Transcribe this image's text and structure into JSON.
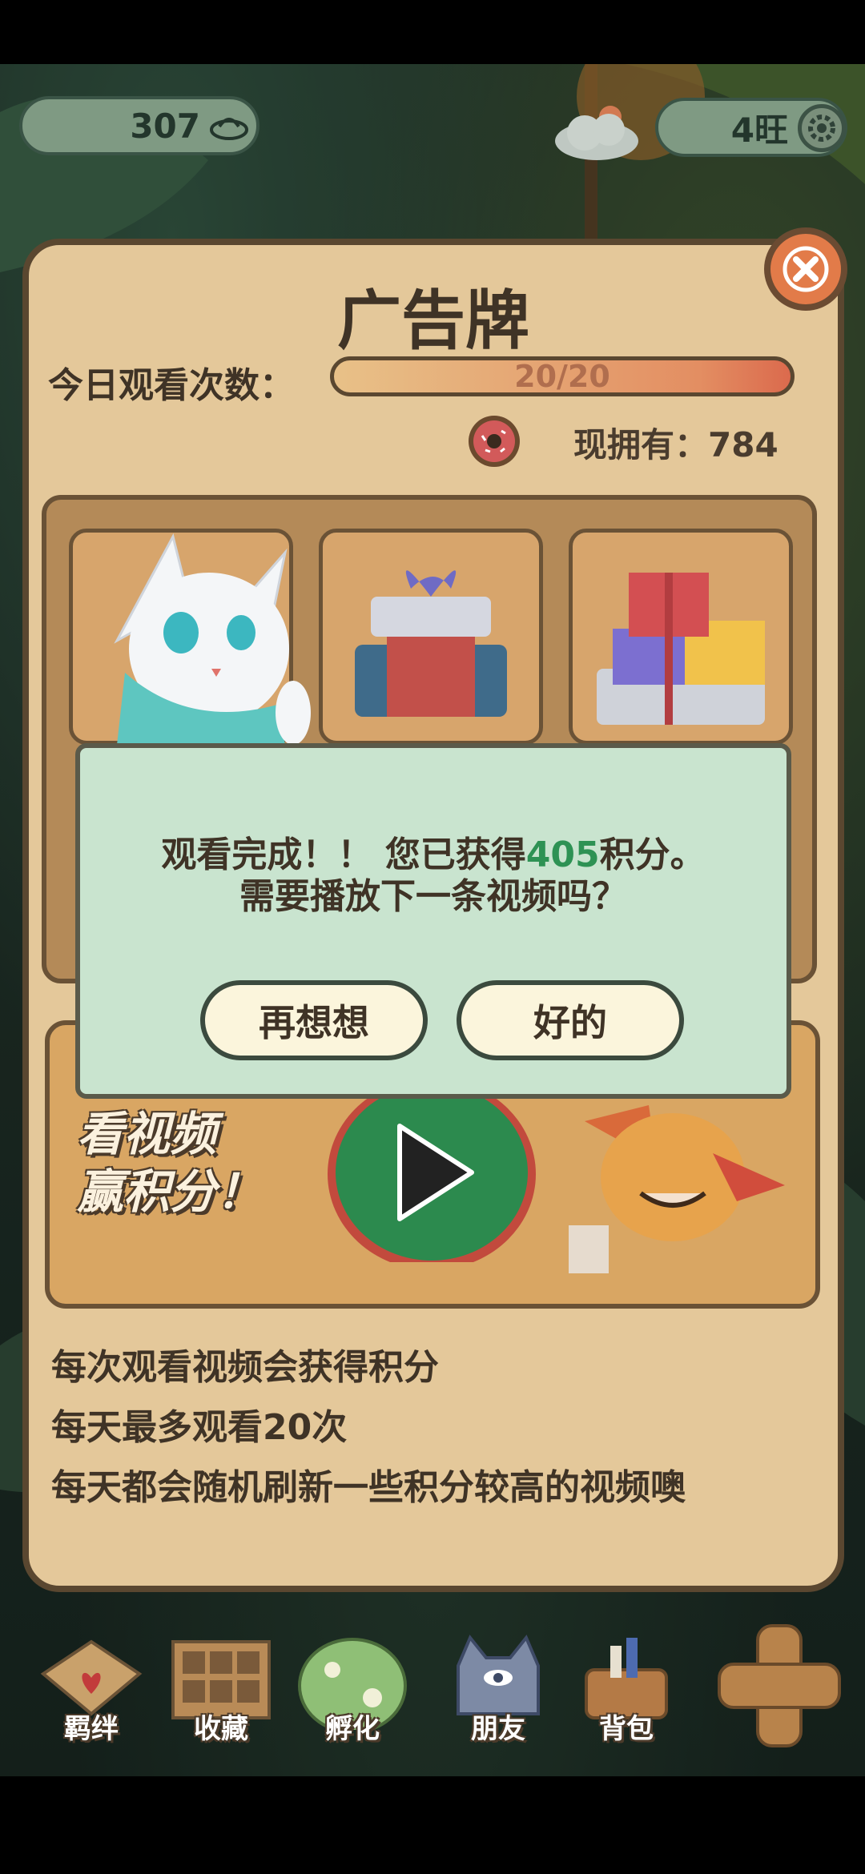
{
  "hud": {
    "coins": "307",
    "currency": "4旺"
  },
  "panel": {
    "title": "广告牌",
    "watch_label": "今日观看次数：",
    "progress_text": "20/20",
    "progress_fraction": 1.0,
    "owned_text": "现拥有：784",
    "video_text_line1": "看视频",
    "video_text_line2": "赢积分！",
    "rules": [
      "每次观看视频会获得积分",
      "每天最多观看20次",
      "每天都会随机刷新一些积分较高的视频噢"
    ]
  },
  "dialog": {
    "line1_prefix": "观看完成！！ 您已获得",
    "line1_points": "405",
    "line1_suffix": "积分。",
    "line2": "需要播放下一条视频吗？",
    "cancel_label": "再想想",
    "ok_label": "好的"
  },
  "nav": {
    "bond": "羁绊",
    "collection": "收藏",
    "hatch": "孵化",
    "friends": "朋友",
    "backpack": "背包"
  },
  "colors": {
    "panel": "#e4c89a",
    "dialog": "#c9e4cf",
    "accent_green": "#2e9254",
    "close": "#e27b49"
  }
}
